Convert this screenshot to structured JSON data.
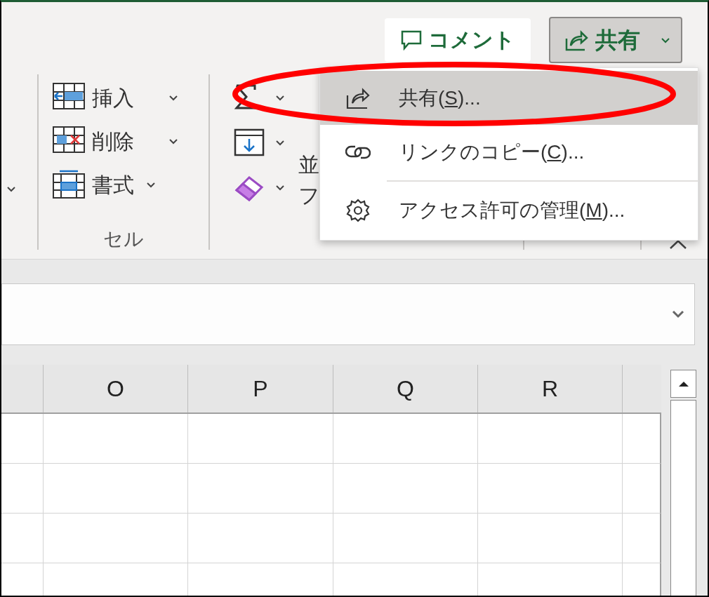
{
  "header_buttons": [
    {
      "kind": "comment",
      "label": "コメント"
    },
    {
      "kind": "share",
      "label": "共有",
      "selected": true
    }
  ],
  "ribbon": {
    "groups": [
      {
        "kind": "cut"
      },
      {
        "kind": "cells",
        "label": "セル",
        "items": [
          {
            "kind": "insert",
            "label": "挿入"
          },
          {
            "kind": "delete",
            "label": "削除"
          },
          {
            "kind": "format",
            "label": "書式"
          }
        ]
      },
      {
        "kind": "editing",
        "items": [
          {
            "kind": "sum"
          },
          {
            "kind": "fill"
          },
          {
            "kind": "clear"
          }
        ],
        "hidden_label_parts": [
          "並",
          "フ"
        ]
      },
      {
        "kind": "analysis"
      }
    ]
  },
  "share_menu": {
    "items": [
      {
        "kind": "share",
        "before": "共有(",
        "access_key": "S",
        "after": ")...",
        "selected": true,
        "circled": true
      },
      {
        "kind": "link",
        "before": "リンクのコピー(",
        "access_key": "C",
        "after": ")...",
        "selected": false
      },
      {
        "kind": "gear",
        "before": "アクセス許可の管理(",
        "access_key": "M",
        "after": ")...",
        "selected": false
      }
    ]
  },
  "sheet": {
    "columns": [
      "O",
      "P",
      "Q",
      "R"
    ]
  }
}
